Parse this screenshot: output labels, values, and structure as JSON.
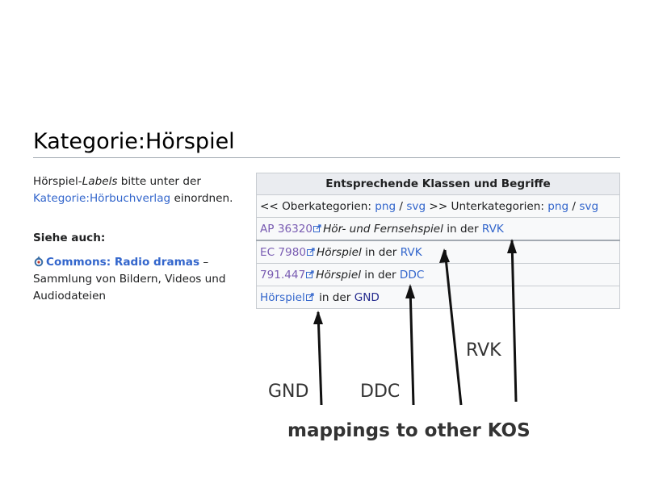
{
  "page": {
    "title": "Kategorie:Hörspiel"
  },
  "intro": {
    "prefix": "Hörspiel-",
    "labels_word": "Labels",
    "middle": " bitte unter der ",
    "link": "Kategorie:Hörbuchverlag",
    "suffix": " einordnen."
  },
  "see_also": {
    "heading": "Siehe auch:",
    "commons_link": "Commons: Radio dramas",
    "commons_desc": " – Sammlung von Bildern, Videos und Audiodateien",
    "icon": "commons-logo-icon"
  },
  "table": {
    "header": "Entsprechende Klassen und Begriffe",
    "nav_row": {
      "prefix": "<< Oberkategorien: ",
      "png1": "png",
      "slash1": " / ",
      "svg1": "svg",
      "middle": " >> Unterkategorien: ",
      "png2": "png",
      "slash2": " / ",
      "svg2": "svg"
    },
    "rows": [
      {
        "code": "AP 36320",
        "term": "Hör- und Fernsehspiel",
        "in_der": " in der ",
        "system": "RVK"
      },
      {
        "code": "EC 7980",
        "term": "Hörspiel",
        "in_der": " in der ",
        "system": "RVK"
      },
      {
        "code": "791.447",
        "term": "Hörspiel",
        "in_der": " in der ",
        "system": "DDC"
      },
      {
        "code": "Hörspiel",
        "term": "",
        "in_der": " in der ",
        "system": "GND"
      }
    ],
    "external_link_icon": "external-link-icon"
  },
  "annotations": {
    "gnd": "GND",
    "ddc": "DDC",
    "rvk": "RVK",
    "caption": "mappings to other KOS"
  },
  "colors": {
    "link": "#3366cc",
    "visited": "#795cb2",
    "table_border": "#c8ccd1",
    "annotation": "#333333",
    "arrow": "#111111"
  }
}
